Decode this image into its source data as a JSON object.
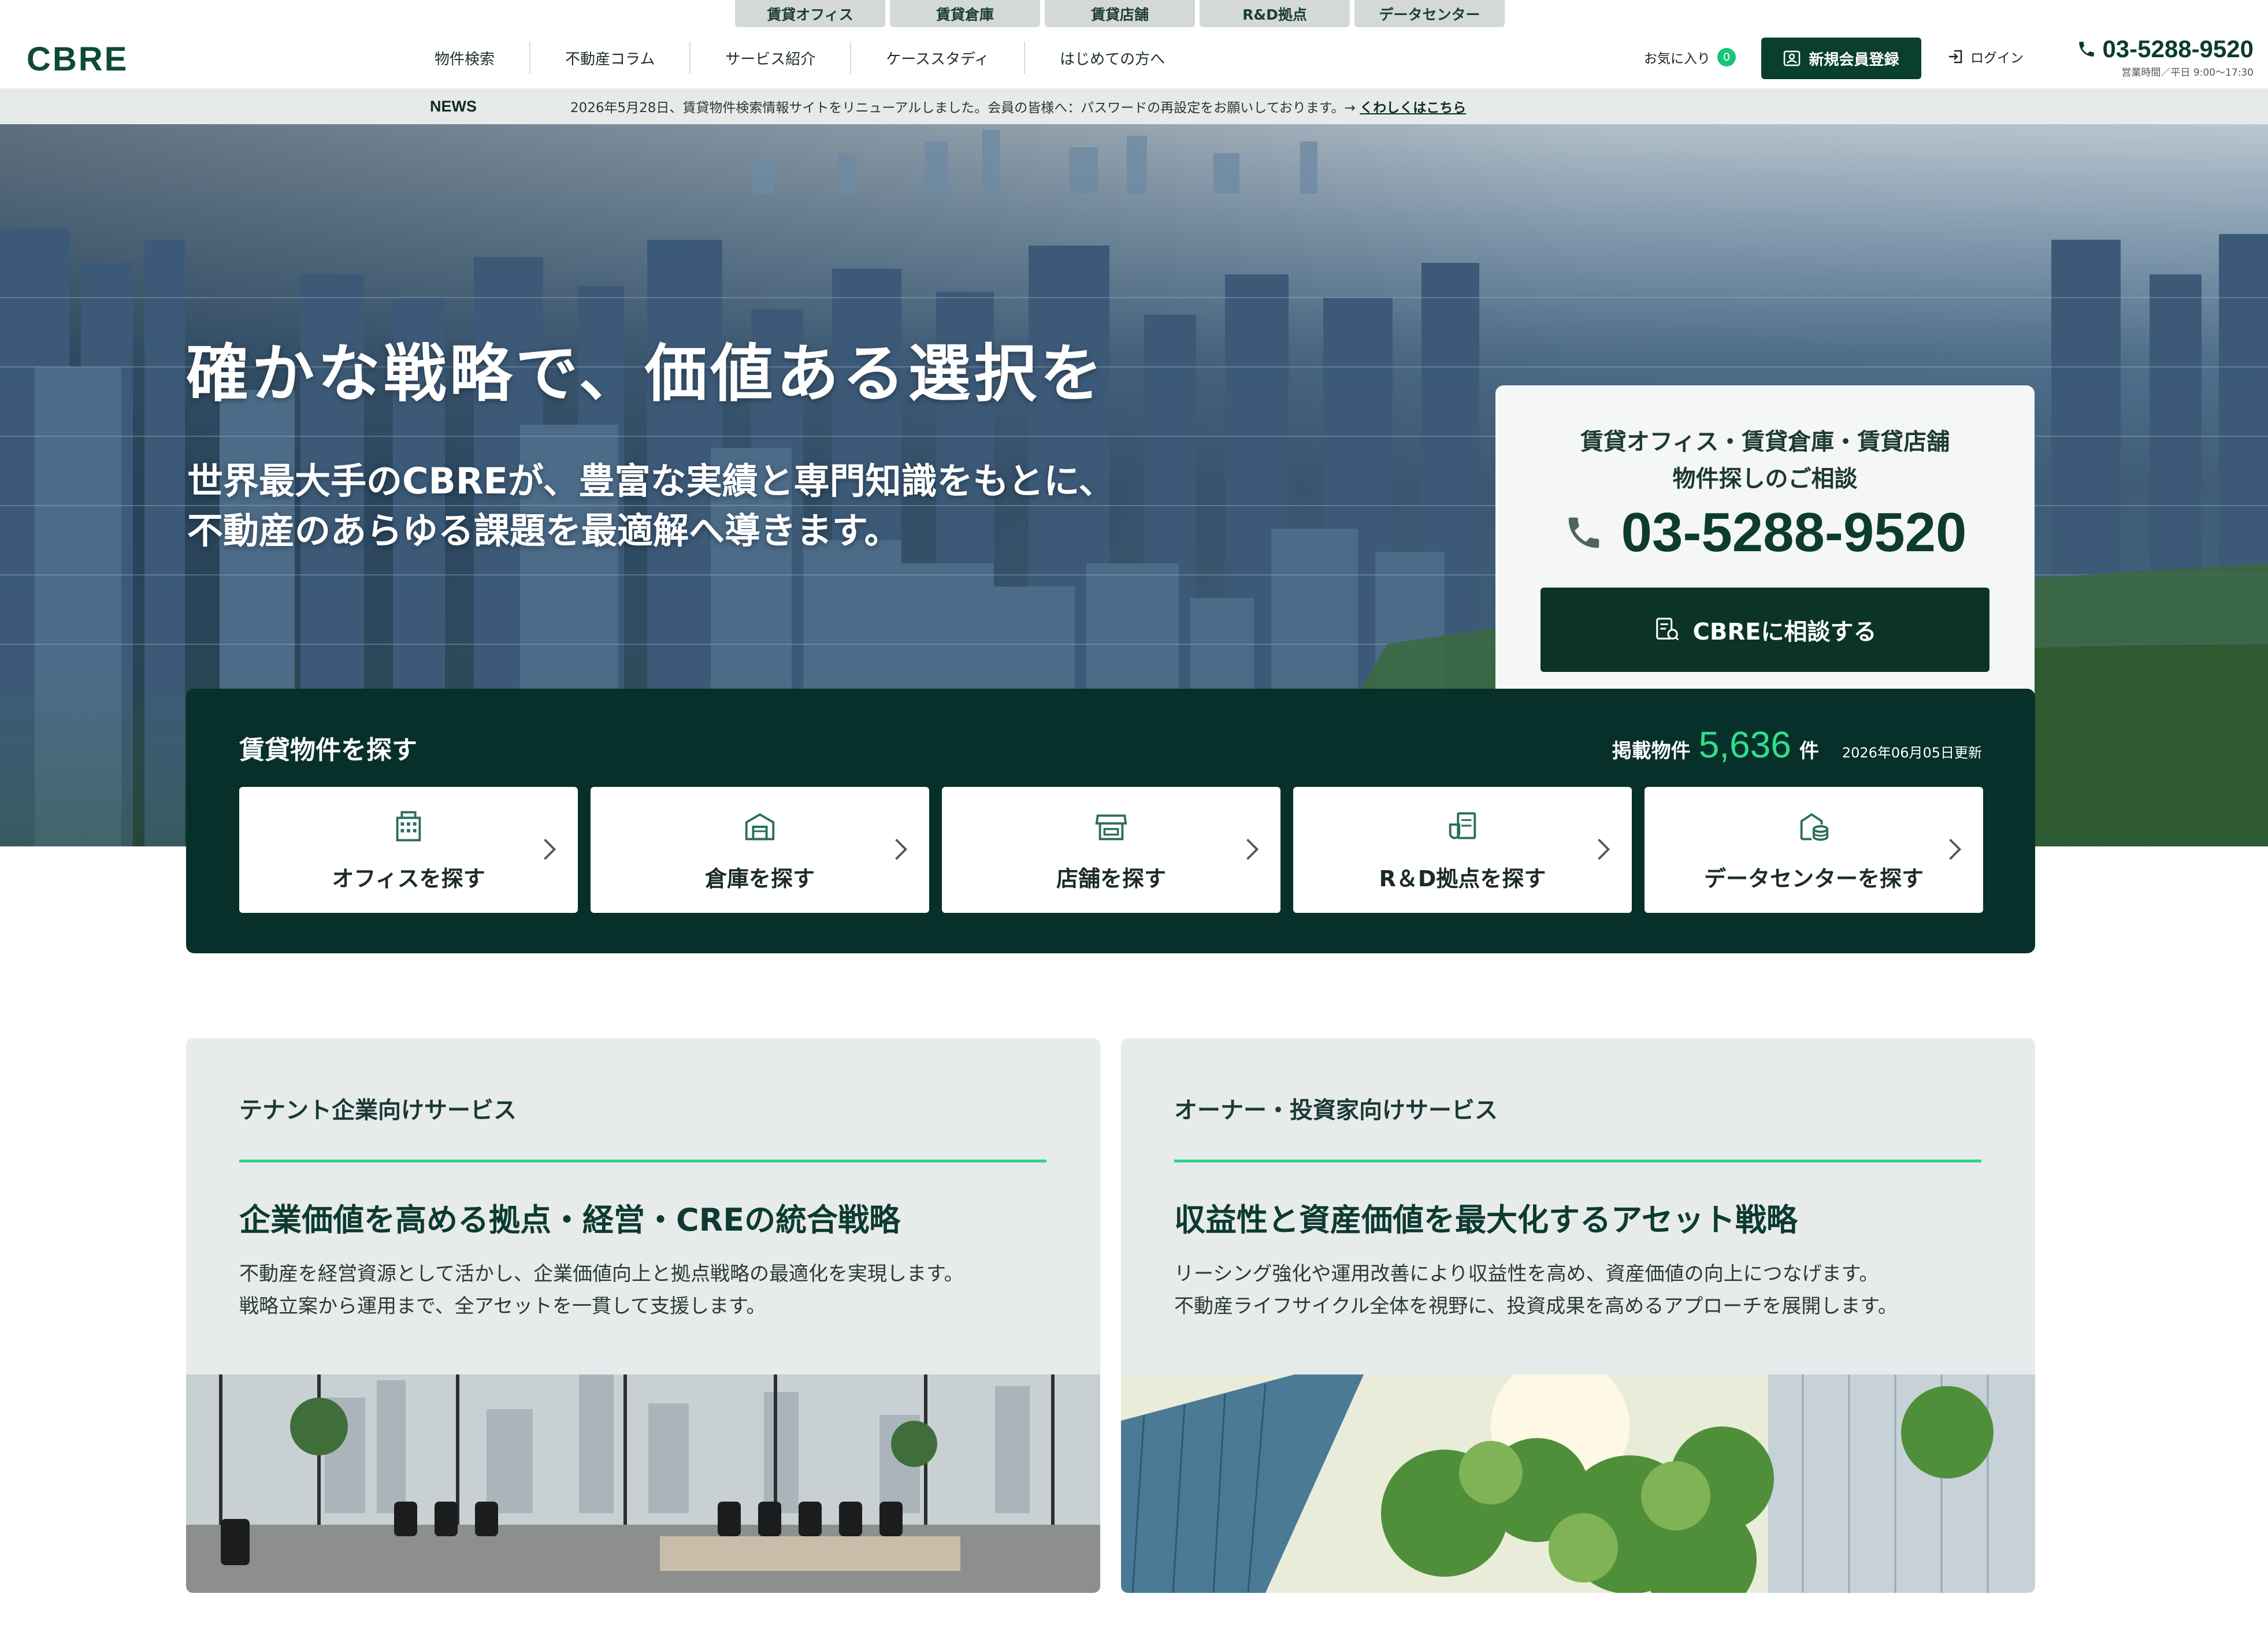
{
  "top_tabs": [
    "賃貸オフィス",
    "賃貸倉庫",
    "賃貸店舗",
    "R&D拠点",
    "データセンター"
  ],
  "header": {
    "logo": "CBRE",
    "nav": [
      "物件検索",
      "不動産コラム",
      "サービス紹介",
      "ケーススタディ",
      "はじめての方へ"
    ],
    "favorites_label": "お気に入り",
    "favorites_count": "0",
    "register_label": "新規会員登録",
    "login_label": "ログイン",
    "phone": "03-5288-9520",
    "hours": "営業時間／平日 9:00〜17:30"
  },
  "news": {
    "label": "NEWS",
    "text": "2026年5月28日、賃貸物件検索情報サイトをリニューアルしました。会員の皆様へ：パスワードの再設定をお願いしております。→",
    "link": "くわしくはこちら"
  },
  "hero": {
    "title": "確かな戦略で、価値ある選択を",
    "sub_line1": "世界最大手のCBREが、豊富な実績と専門知識をもとに、",
    "sub_line2": "不動産のあらゆる課題を最適解へ導きます。"
  },
  "contact": {
    "lead_line1": "賃貸オフィス・賃貸倉庫・賃貸店舗",
    "lead_line2": "物件探しのご相談",
    "phone": "03-5288-9520",
    "button": "CBREに相談する"
  },
  "search": {
    "title": "賃貸物件を探す",
    "listing_label": "掲載物件",
    "listing_count": "5,636",
    "listing_unit": "件",
    "updated": "2026年06月05日更新",
    "categories": [
      {
        "label": "オフィスを探す",
        "icon": "office-building-icon"
      },
      {
        "label": "倉庫を探す",
        "icon": "warehouse-icon"
      },
      {
        "label": "店舗を探す",
        "icon": "store-icon"
      },
      {
        "label": "R＆D拠点を探す",
        "icon": "lab-document-icon"
      },
      {
        "label": "データセンターを探す",
        "icon": "datacenter-icon"
      }
    ]
  },
  "services": {
    "tenant": {
      "eyebrow": "テナント企業向けサービス",
      "heading": "企業価値を高める拠点・経営・CREの統合戦略",
      "body_line1": "不動産を経営資源として活かし、企業価値向上と拠点戦略の最適化を実現します。",
      "body_line2": "戦略立案から運用まで、全アセットを一貫して支援します。"
    },
    "owner": {
      "eyebrow": "オーナー・投資家向けサービス",
      "heading": "収益性と資産価値を最大化するアセット戦略",
      "body_line1": "リーシング強化や運用改善により収益性を高め、資産価値の向上につなげます。",
      "body_line2": "不動産ライフサイクル全体を視野に、投資成果を高めるアプローチを展開します。"
    }
  },
  "colors": {
    "brand_green": "#0a3f30",
    "accent_green": "#2fd388",
    "panel_dark": "#07302a"
  }
}
